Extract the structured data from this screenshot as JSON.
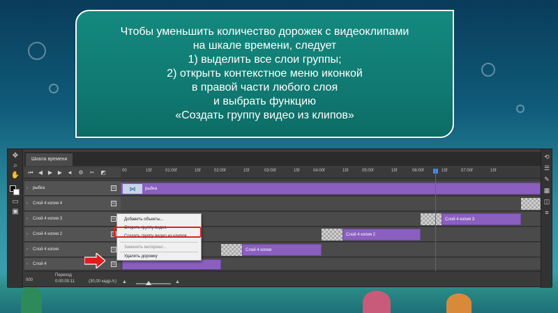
{
  "card": {
    "lines": [
      "Чтобы уменьшить количество дорожек с видеоклипами",
      "на шкале времени, следует",
      "1) выделить все слои группы;",
      "2) открыть контекстное меню иконкой",
      "в правой части любого слоя",
      "и выбрать функцию",
      "«Создать группу видео из клипов»"
    ]
  },
  "panel": {
    "tab": "Шкала времени",
    "ruler_ticks": [
      "00",
      "15f",
      "01:00f",
      "15f",
      "02:00f",
      "15f",
      "03:00f",
      "15f",
      "04:00f",
      "15f",
      "05:00f",
      "15f",
      "06:00f",
      "15f",
      "07:00f",
      "15f"
    ],
    "layers": [
      {
        "name": "рыбка",
        "clip": "рыбка"
      },
      {
        "name": "Слой 4 копия 4",
        "clip": ""
      },
      {
        "name": "Слой 4 копия 3",
        "clip": "Слой 4 копия 3"
      },
      {
        "name": "Слой 4 копия 2",
        "clip": "Слой 4 копия 2"
      },
      {
        "name": "Слой 4 копия",
        "clip": "Слой 4 копия"
      },
      {
        "name": "Слой 4",
        "clip": ""
      }
    ],
    "bottom": {
      "transition_label": "Переход",
      "timecode": "0:00:00:11",
      "fps": "(30,00 кадр./с)",
      "left_code": "000"
    }
  },
  "context_menu": {
    "items": [
      {
        "label": "Добавить объекты...",
        "enabled": true
      },
      {
        "label": "Стереть группу видео",
        "enabled": true
      },
      {
        "label": "Создать группу видео из клипов",
        "enabled": true,
        "highlighted": true
      },
      {
        "label": "Заменить материал...",
        "enabled": false
      },
      {
        "label": "Удалить дорожку",
        "enabled": true
      }
    ]
  },
  "colors": {
    "card_bg": "#107a72",
    "clip_purple": "#8a5fc0",
    "highlight_red": "#e02020"
  }
}
